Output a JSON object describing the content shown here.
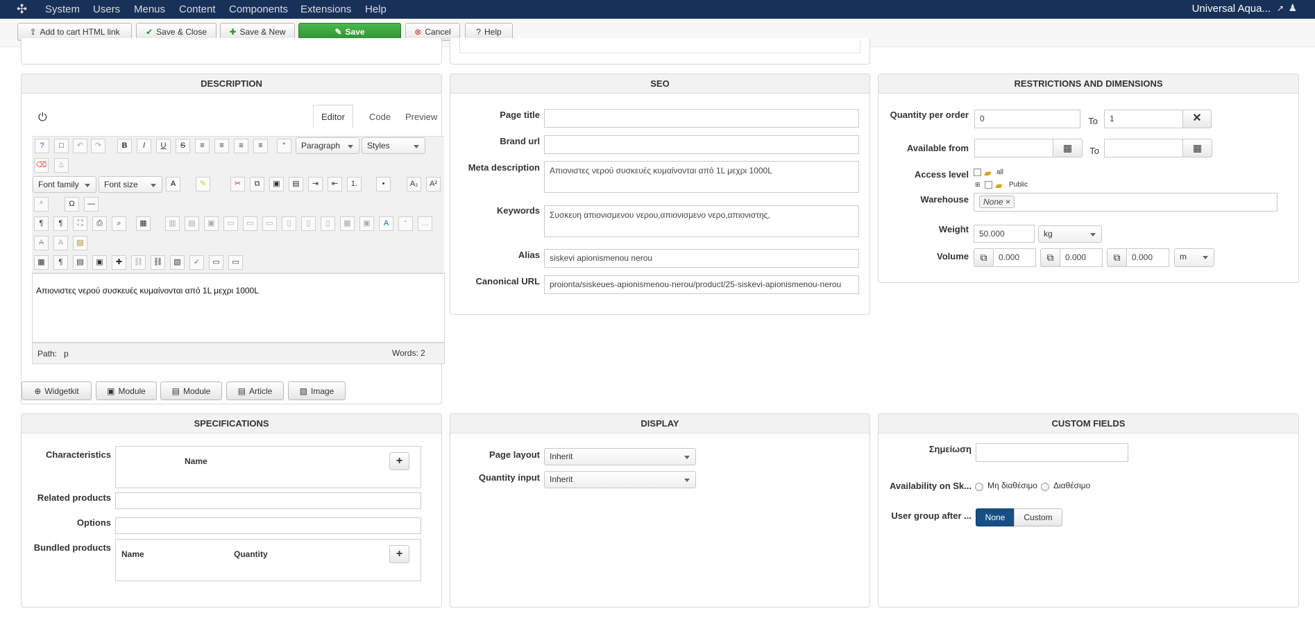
{
  "topbar": {
    "menu": [
      "System",
      "Users",
      "Menus",
      "Content",
      "Components",
      "Extensions",
      "Help"
    ],
    "site_name": "Universal Aqua...",
    "user_icon": "user-icon"
  },
  "toolbar": {
    "add_to_cart": "Add to cart HTML link",
    "save_close": "Save & Close",
    "save_new": "Save & New",
    "save": "Save",
    "cancel": "Cancel",
    "help": "Help"
  },
  "description": {
    "title": "DESCRIPTION",
    "tabs": [
      "Editor",
      "Code",
      "Preview"
    ],
    "paragraph": "Paragraph",
    "styles": "Styles",
    "font_family": "Font family",
    "font_size": "Font size",
    "content": "Απιονιστες νερού συσκευές κυμαίνονται από 1L μεχρι 1000L",
    "path_label": "Path:",
    "path_value": "p",
    "words_label": "Words:",
    "words_count": "2",
    "buttons": [
      "Widgetkit",
      "Module",
      "Module",
      "Article",
      "Image"
    ]
  },
  "seo": {
    "title": "SEO",
    "page_title_label": "Page title",
    "page_title": "",
    "brand_url_label": "Brand url",
    "brand_url": "",
    "meta_label": "Meta description",
    "meta": "Απιονιστες νερού συσκευές κυμαίνονται από 1L μεχρι 1000L",
    "keywords_label": "Keywords",
    "keywords": "Συσκευη απιονισμενου νερου,απιονισμενο νερο,απιονιστης,",
    "alias_label": "Alias",
    "alias": "siskevi apionismenou nerou",
    "canonical_label": "Canonical URL",
    "canonical": "proionta/siskeues-apionismenou-nerou/product/25-siskevi-apionismenou-nerou"
  },
  "restrictions": {
    "title": "RESTRICTIONS AND DIMENSIONS",
    "quantity_label": "Quantity per order",
    "quantity_from": "0",
    "to_label": "To",
    "quantity_to": "1",
    "available_label": "Available from",
    "available_from": "",
    "available_to": "",
    "access_label": "Access level",
    "access_all": "all",
    "access_public": "Public",
    "warehouse_label": "Warehouse",
    "warehouse": "None",
    "weight_label": "Weight",
    "weight": "50.000",
    "weight_unit": "kg",
    "volume_label": "Volume",
    "volume": [
      "0.000",
      "0.000",
      "0.000"
    ],
    "volume_unit": "m"
  },
  "specifications": {
    "title": "SPECIFICATIONS",
    "characteristics_label": "Characteristics",
    "name_header": "Name",
    "related_label": "Related products",
    "options_label": "Options",
    "bundled_label": "Bundled products",
    "bundled_name": "Name",
    "bundled_quantity": "Quantity"
  },
  "display": {
    "title": "DISPLAY",
    "page_layout_label": "Page layout",
    "page_layout": "Inherit",
    "quantity_input_label": "Quantity input",
    "quantity_input": "Inherit"
  },
  "custom": {
    "title": "CUSTOM FIELDS",
    "note_label": "Σημείωση",
    "availability_label": "Availability on Sk...",
    "not_available": "Μη διαθέσιμο",
    "available": "Διαθέσιμο",
    "user_group_label": "User group after ...",
    "none": "None",
    "custom": "Custom"
  },
  "colors": {
    "topbar": "#183158",
    "save": "#2f8f2f",
    "active": "#164f84"
  }
}
